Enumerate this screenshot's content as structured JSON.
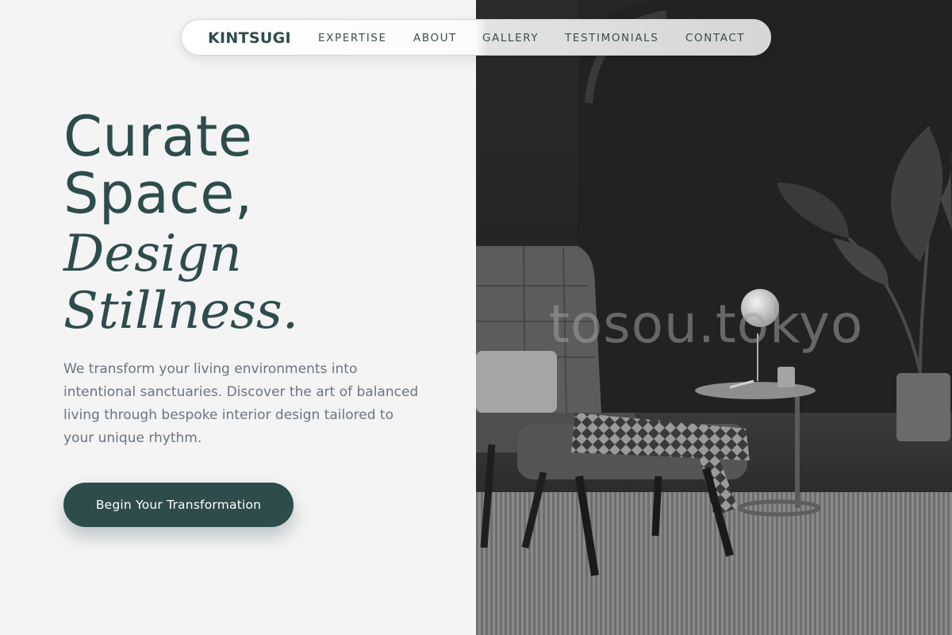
{
  "nav": {
    "brand": "KINTSUGI",
    "links": [
      {
        "label": "EXPERTISE"
      },
      {
        "label": "ABOUT"
      },
      {
        "label": "GALLERY"
      },
      {
        "label": "TESTIMONIALS"
      },
      {
        "label": "CONTACT"
      }
    ]
  },
  "hero": {
    "heading_line1": "Curate",
    "heading_line2": "Space,",
    "heading_line3": "Design",
    "heading_line4": "Stillness.",
    "lead": "We transform your living environments into intentional sanctuaries. Discover the art of balanced living through bespoke interior design tailored to your unique rhythm.",
    "cta_label": "Begin Your Transformation"
  },
  "image": {
    "watermark": "tosou.tokyo"
  },
  "colors": {
    "accent": "#2e4c4c",
    "background": "#f4f4f4",
    "body_text": "#6b7480"
  }
}
